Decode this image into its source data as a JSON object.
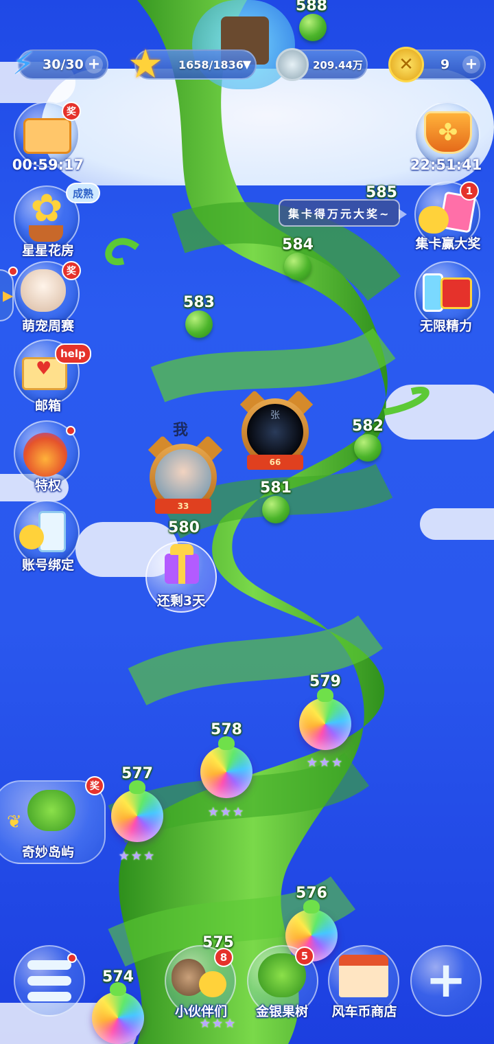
{
  "top_bar": {
    "energy": "30/30",
    "stars": "1658/1836",
    "coins": "209.44万",
    "gold": "9"
  },
  "left_menu": [
    {
      "label": "",
      "timer": "00:59:17",
      "badge": "奖"
    },
    {
      "label": "星星花房",
      "tag": "成熟"
    },
    {
      "label": "萌宠周赛",
      "badge": "奖"
    },
    {
      "label": "邮箱",
      "tag": "help"
    },
    {
      "label": "特权"
    },
    {
      "label": "账号绑定"
    }
  ],
  "right_menu": [
    {
      "label": "",
      "timer": "22:51:41"
    },
    {
      "label": "集卡赢大奖",
      "badge": "1"
    },
    {
      "label": "无限精力"
    }
  ],
  "hint_text": "集卡得万元大奖~",
  "me_label": "我",
  "avatars": {
    "me_level": "33",
    "friend_level": "66",
    "friend_name": "张"
  },
  "gift_label": "还剩3天",
  "island": {
    "label": "奇妙岛屿",
    "badge": "奖"
  },
  "levels": [
    "588",
    "585",
    "584",
    "583",
    "582",
    "581",
    "580",
    "579",
    "578",
    "577",
    "576",
    "575",
    "574"
  ],
  "bottom_nav": [
    {
      "label": "",
      "name": "menu"
    },
    {
      "label": "小伙伴们",
      "badge": "8"
    },
    {
      "label": "金银果树",
      "badge": "5"
    },
    {
      "label": "风车币商店"
    },
    {
      "label": "",
      "name": "plus"
    }
  ],
  "colors": {
    "sky": "#2a58ee",
    "stalk": "#4fbf2c",
    "badge": "#e5322b"
  },
  "stars_mark": "★★★"
}
